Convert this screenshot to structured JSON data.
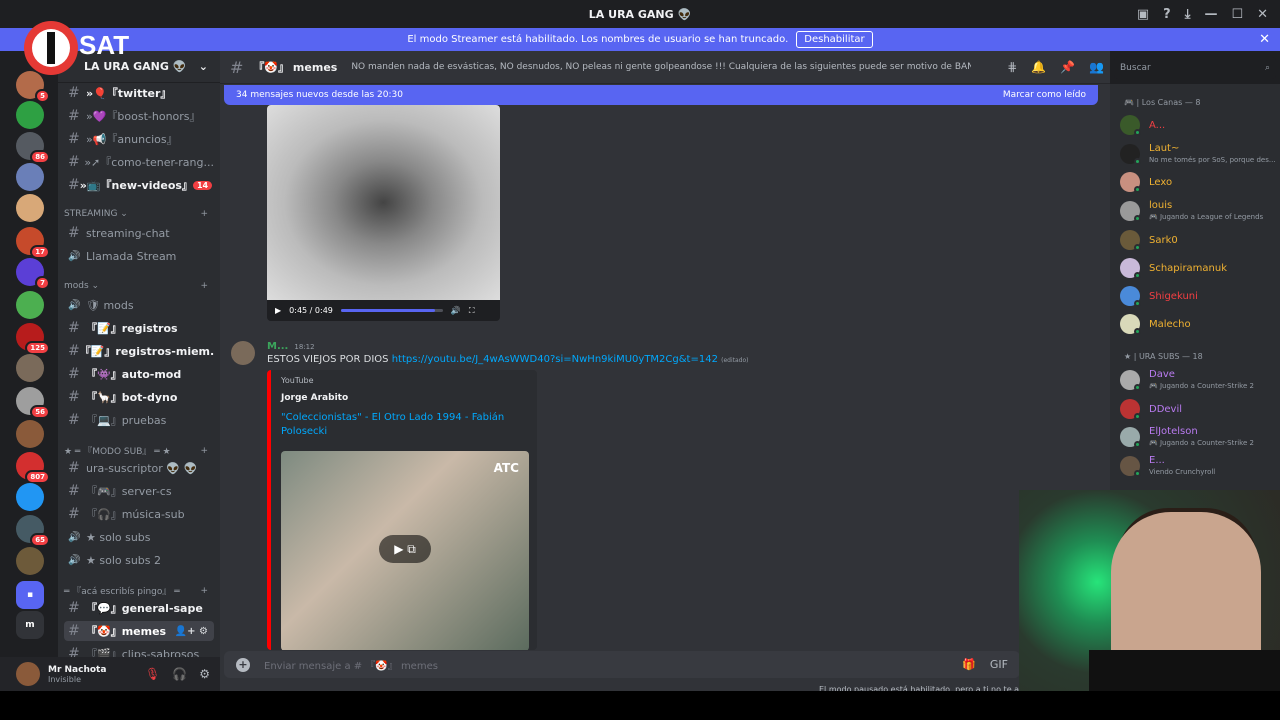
{
  "window": {
    "title": "LA URA GANG 👽",
    "controls": [
      "—",
      "☐",
      "✕"
    ]
  },
  "banner": {
    "text": "El modo Streamer está habilitado. Los nombres de usuario se han truncado.",
    "button": "Deshabilitar"
  },
  "logo": {
    "text": "I·SAT"
  },
  "servers": [
    {
      "badge": "5",
      "color": "#b36b4a"
    },
    {
      "badge": "",
      "color": "#2ea043"
    },
    {
      "badge": "86",
      "color": "#555a61"
    },
    {
      "badge": "",
      "color": "#6a7fb8"
    },
    {
      "badge": "",
      "color": "#d8a878"
    },
    {
      "badge": "17",
      "color": "#c64a2b"
    },
    {
      "badge": "7",
      "color": "#5b3fd6"
    },
    {
      "badge": "",
      "color": "#4caf50"
    },
    {
      "badge": "125",
      "color": "#b71c1c"
    },
    {
      "badge": "",
      "color": "#7a6a5a"
    },
    {
      "badge": "56",
      "color": "#9e9e9e"
    },
    {
      "badge": "",
      "color": "#8a5a3a"
    },
    {
      "badge": "807",
      "color": "#d32f2f"
    },
    {
      "badge": "",
      "color": "#2196f3"
    },
    {
      "badge": "65",
      "color": "#455a64"
    },
    {
      "badge": "",
      "color": "#6d5a3a"
    },
    {
      "badge": "",
      "color": "#5865f2",
      "glyph": "▪"
    },
    {
      "badge": "",
      "color": "#313338",
      "glyph": "m"
    }
  ],
  "guild": {
    "name": "LA URA GANG 👽"
  },
  "channels_top": [
    {
      "name": "»🎈『twitter』",
      "unread": true,
      "badge": ""
    },
    {
      "name": "»💜『boost-honors』",
      "unread": false,
      "badge": ""
    },
    {
      "name": "»📢『anuncios』",
      "unread": false,
      "badge": ""
    },
    {
      "name": "»➚『como-tener-rang...",
      "unread": false,
      "badge": ""
    },
    {
      "name": "»📺『new-videos』",
      "unread": true,
      "badge": "14"
    }
  ],
  "cat_streaming": "STREAMING ⌄",
  "channels_streaming": [
    {
      "name": "streaming-chat",
      "voice": false
    },
    {
      "name": "Llamada Stream",
      "voice": true
    }
  ],
  "cat_mods": "mods ⌄",
  "channels_mods": [
    {
      "name": "🛡 mods",
      "voice": true,
      "unread": false
    },
    {
      "name": "『📝』registros",
      "voice": false,
      "unread": true
    },
    {
      "name": "『📝』registros-miem...",
      "voice": false,
      "unread": true
    },
    {
      "name": "『👾』auto-mod",
      "voice": false,
      "unread": true
    },
    {
      "name": "『🦙』bot-dyno",
      "voice": false,
      "unread": true
    },
    {
      "name": "『💻』pruebas",
      "voice": false,
      "unread": false
    }
  ],
  "cat_sub": "★ ═ 『MODO SUB』 ═ ★",
  "channels_sub": [
    {
      "name": "ura-suscriptor 👽 👽",
      "voice": false
    },
    {
      "name": "『🎮』server-cs",
      "voice": false
    },
    {
      "name": "『🎧』música-sub",
      "voice": false
    },
    {
      "name": "★ solo subs",
      "voice": true
    },
    {
      "name": "★ solo subs 2",
      "voice": true
    }
  ],
  "cat_general": "═ 『acá escribís pingo』 ═",
  "channels_general": [
    {
      "name": "『💬』general-sape",
      "unread": true,
      "sel": false
    },
    {
      "name": "『🤡』memes",
      "unread": true,
      "sel": true
    },
    {
      "name": "『🎬』clips-sabrosos",
      "unread": false,
      "sel": false
    }
  ],
  "user": {
    "name": "Mr Nachota",
    "status": "Invisible"
  },
  "channel": {
    "name": "『🤡』 memes",
    "topic": "NO manden nada de esvásticas, NO desnudos, NO peleas ni gente golpeandose !!! Cualquiera de las siguientes puede ser motivo de BAN, cuiden el stream!"
  },
  "search": {
    "placeholder": "Buscar"
  },
  "newbar": {
    "text": "34 mensajes nuevos desde las 20:30",
    "action": "Marcar como leído"
  },
  "video": {
    "time": "0:45 / 0:49",
    "progress": 0.92
  },
  "message": {
    "author": "M...",
    "time": "18:12",
    "text": "ESTOS VIEJOS POR DIOS ",
    "link": "https://youtu.be/J_4wAsWWD40?si=NwHn9kiMU0yTM2Cg&t=142",
    "edited": "(editado)",
    "embed": {
      "provider": "YouTube",
      "author": "Jorge Arabito",
      "title": "\"Coleccionistas\" - El Otro Lado 1994 - Fabián Polosecki",
      "watermark": "ATC"
    }
  },
  "composer": {
    "placeholder": "Enviar mensaje a # 『🤡』 memes"
  },
  "pause_note": "El modo pausado está habilitado, pero a ti no te af",
  "members": {
    "group1": "🎮 | Los Canas — 8",
    "group1_members": [
      {
        "name": "A...",
        "activity": "",
        "color": "#f23f43",
        "av": "#3a5a2a"
      },
      {
        "name": "Laut~",
        "activity": "No me tomés por SoS, porque des...",
        "color": "#f0b232",
        "av": "#222"
      },
      {
        "name": "Lexo",
        "activity": "",
        "color": "#f0b232",
        "av": "#c89080"
      },
      {
        "name": "louis",
        "activity": "🎮 Jugando a League of Legends",
        "color": "#f0b232",
        "av": "#9a9a9a"
      },
      {
        "name": "Sark0",
        "activity": "",
        "color": "#f0b232",
        "av": "#6a5a3a"
      },
      {
        "name": "Schapiramanuk",
        "activity": "",
        "color": "#f0b232",
        "av": "#c9b9d9"
      },
      {
        "name": "Shigekuni",
        "activity": "",
        "color": "#f23f43",
        "av": "#4a8ad9"
      },
      {
        "name": "Malecho",
        "activity": "",
        "color": "#f0b232",
        "av": "#d9d9b9"
      }
    ],
    "group2": "★ | URA SUBS — 18",
    "group2_members": [
      {
        "name": "Dave",
        "activity": "🎮 Jugando a Counter-Strike 2",
        "color": "#b97bf0",
        "av": "#aaa"
      },
      {
        "name": "DDevil",
        "activity": "",
        "color": "#b97bf0",
        "av": "#b33"
      },
      {
        "name": "ElJotelson",
        "activity": "🎮 Jugando a Counter-Strike 2",
        "color": "#b97bf0",
        "av": "#9aa"
      },
      {
        "name": "E...",
        "activity": "Viendo Crunchyroll",
        "color": "#b97bf0",
        "av": "#654"
      }
    ]
  }
}
